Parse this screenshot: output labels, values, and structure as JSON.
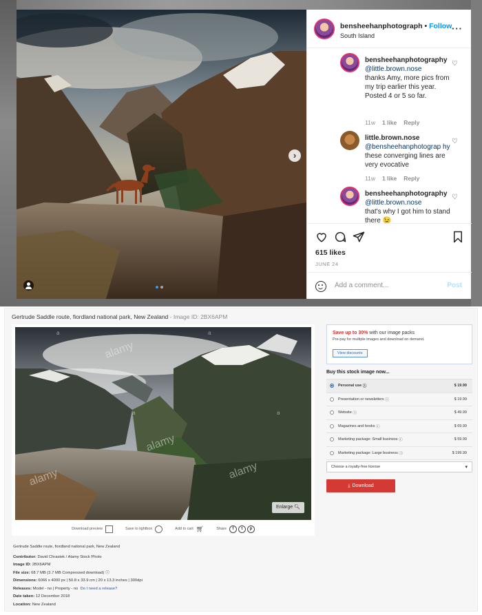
{
  "instagram": {
    "username": "bensheehanphotograph",
    "separator": " • ",
    "follow_label": "Follow",
    "location": "South Island",
    "more_label": "···",
    "comments": [
      {
        "user": "bensheehanphotography",
        "mention": "@little.brown.nose",
        "text": "thanks Amy, more pics from my trip earlier this year. Posted 4 or 5 so far.",
        "time": "11w",
        "likes": "1 like",
        "reply": "Reply"
      },
      {
        "user": "little.brown.nose",
        "mention": "@bensheehanphotograp hy",
        "text": "these converging lines are very evocative",
        "time": "11w",
        "likes": "1 like",
        "reply": "Reply"
      },
      {
        "user": "bensheehanphotography",
        "mention": "@little.brown.nose",
        "text": "that's why I got him to stand there 😉",
        "time": "",
        "likes": "",
        "reply": ""
      }
    ],
    "likes": "615 likes",
    "date": "JUNE 24",
    "comment_placeholder": "Add a comment...",
    "post_label": "Post",
    "next_arrow": "›"
  },
  "alamy": {
    "title": "Gertrude Saddle route, fiordland national park, New Zealand",
    "image_id_label": "Image ID: 2BX6APM",
    "enlarge_label": "Enlarge",
    "toolbar": {
      "download_preview": "Download preview",
      "save_lightbox": "Save to lightbox",
      "add_cart": "Add to cart",
      "share": "Share",
      "share_icons": [
        "f",
        "t",
        "p"
      ]
    },
    "watermark": "alamy",
    "watermark_letter": "a",
    "details": {
      "title": "Gertrude Saddle route, fiordland national park, New Zealand",
      "contributor_label": "Contributor:",
      "contributor": "David Chrastek / Alamy Stock Photo",
      "image_id_label": "Image ID:",
      "image_id": "2BX6APM",
      "file_size_label": "File size:",
      "file_size": "68.7 MB (3.7 MB Compressed download)",
      "dimensions_label": "Dimensions:",
      "dimensions": "6066 x 4000 px | 50.8 x 33.9 cm | 20 x 13.3 inches | 300dpi",
      "releases_label": "Releases:",
      "releases": "Model - no | Property - no",
      "releases_link": "Do I need a release?",
      "date_taken_label": "Date taken:",
      "date_taken": "12 December 2018",
      "location_label": "Location:",
      "location": "New Zealand"
    },
    "promo": {
      "highlight": "Save up to 30%",
      "title_rest": " with our image packs",
      "subtitle": "Pre-pay for multiple images and download on demand.",
      "button": "View discounts"
    },
    "buy_title": "Buy this stock image now...",
    "licenses": [
      {
        "label": "Personal use",
        "price": "$ 19.99",
        "selected": true
      },
      {
        "label": "Presentation or newsletters",
        "price": "$ 19.99",
        "selected": false
      },
      {
        "label": "Website",
        "price": "$ 49.99",
        "selected": false
      },
      {
        "label": "Magazines and books",
        "price": "$ 69.99",
        "selected": false
      },
      {
        "label": "Marketing package: Small business",
        "price": "$ 59.99",
        "selected": false
      },
      {
        "label": "Marketing package: Large business",
        "price": "$ 199.99",
        "selected": false
      }
    ],
    "info_glyph": "ⓘ",
    "royalty_free_select": "Choose a royalty-free license",
    "download_label": "Download",
    "download_glyph": "⤓"
  },
  "colors": {
    "instagram_blue": "#0095f6",
    "alamy_red": "#d43a34",
    "promo_red": "#d0312d"
  }
}
